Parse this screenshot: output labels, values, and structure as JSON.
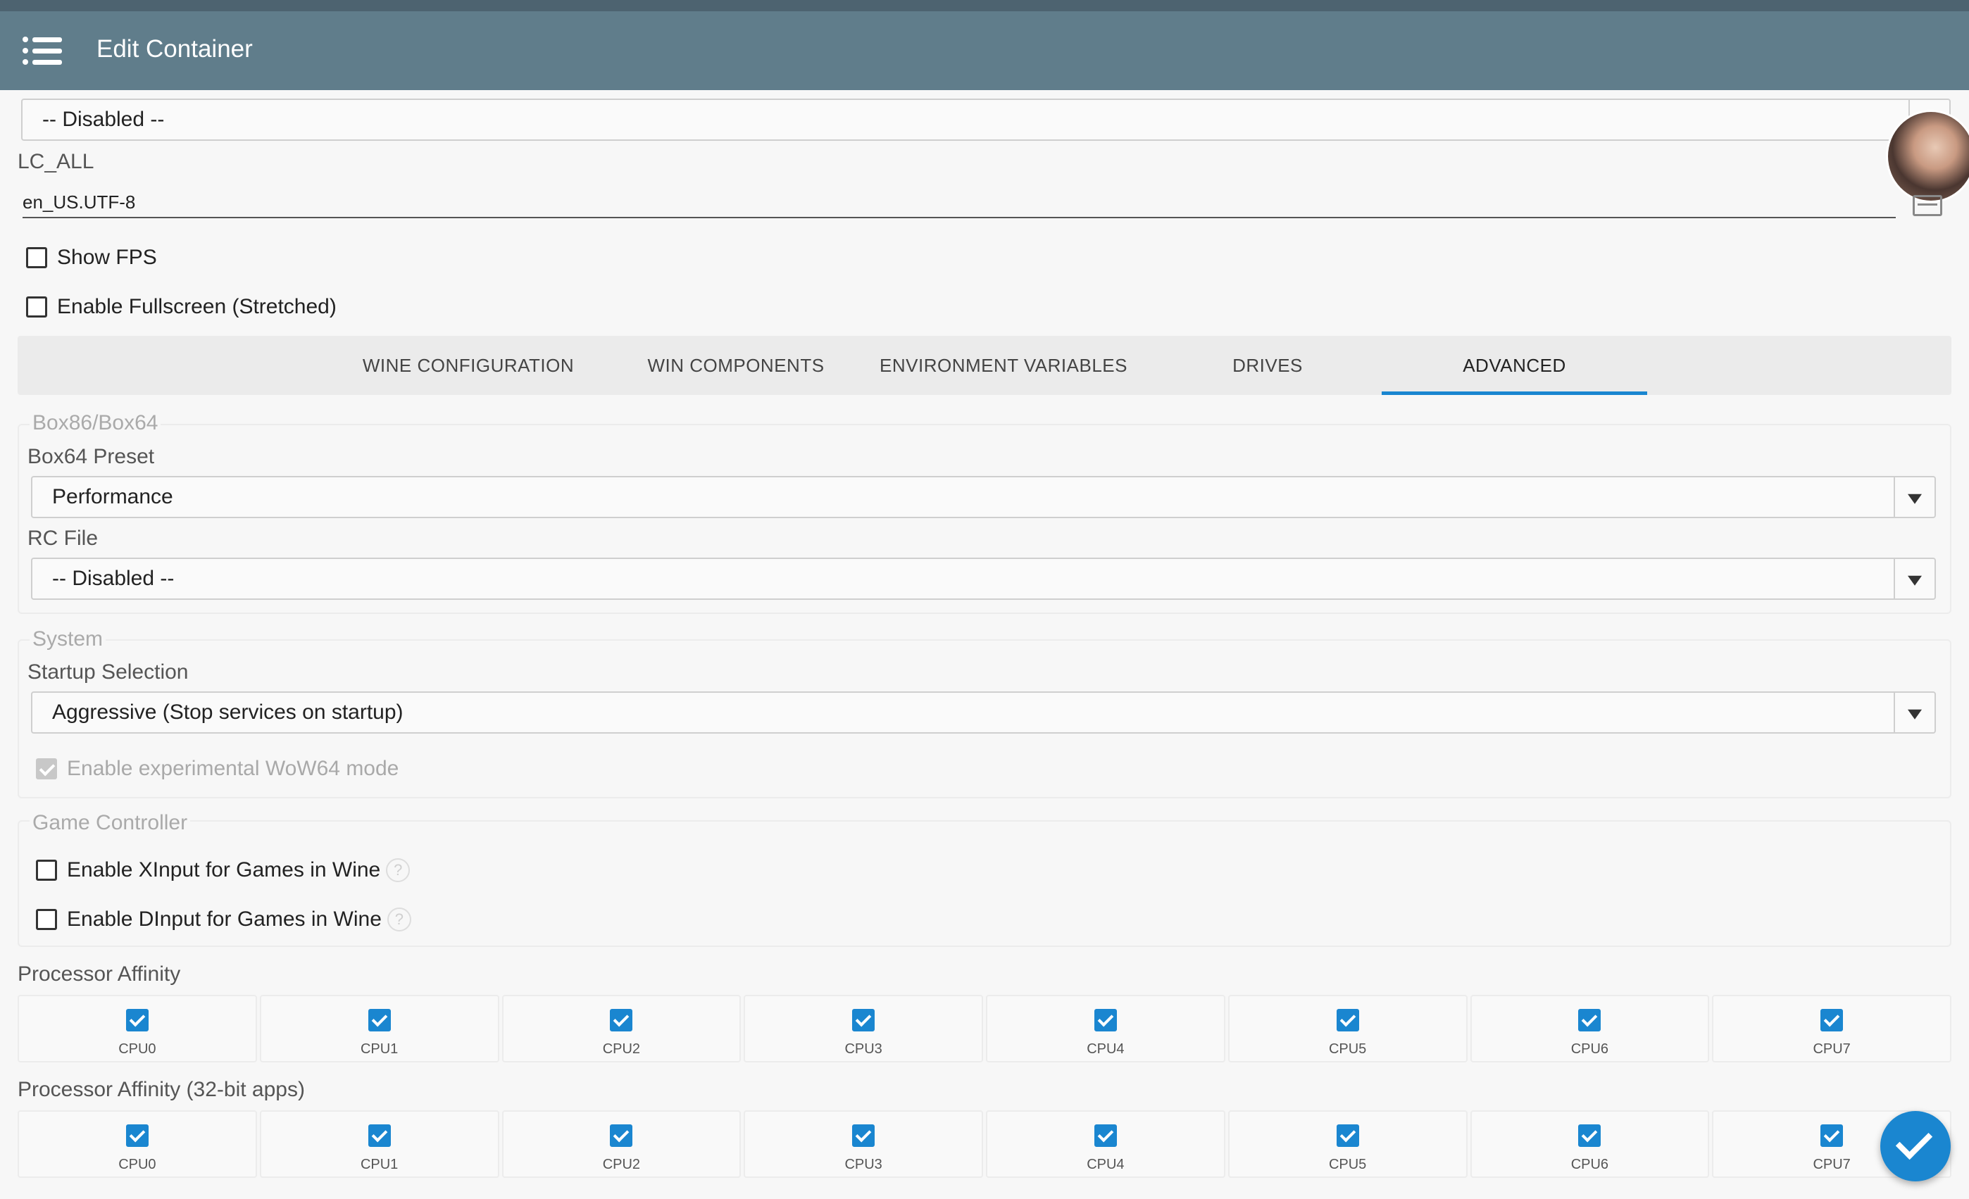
{
  "app": {
    "title": "Edit Container"
  },
  "top": {
    "select_value": "-- Disabled --",
    "lc_all_label": "LC_ALL",
    "lc_all_value": "en_US.UTF-8",
    "show_fps": {
      "label": "Show FPS",
      "checked": false
    },
    "fullscreen": {
      "label": "Enable Fullscreen (Stretched)",
      "checked": false
    }
  },
  "tabs": [
    {
      "label": "WINE CONFIGURATION",
      "active": false
    },
    {
      "label": "WIN COMPONENTS",
      "active": false
    },
    {
      "label": "ENVIRONMENT VARIABLES",
      "active": false
    },
    {
      "label": "DRIVES",
      "active": false
    },
    {
      "label": "ADVANCED",
      "active": true
    }
  ],
  "box": {
    "group_title": "Box86/Box64",
    "preset_label": "Box64 Preset",
    "preset_value": "Performance",
    "rc_label": "RC File",
    "rc_value": "-- Disabled --"
  },
  "system": {
    "group_title": "System",
    "startup_label": "Startup Selection",
    "startup_value": "Aggressive (Stop services on startup)",
    "wow64": {
      "label": "Enable experimental WoW64 mode",
      "checked": true,
      "disabled": true
    }
  },
  "controller": {
    "group_title": "Game Controller",
    "xinput": {
      "label": "Enable XInput for Games in Wine",
      "checked": false
    },
    "dinput": {
      "label": "Enable DInput for Games in Wine",
      "checked": false
    },
    "help_glyph": "?"
  },
  "affinity": {
    "label": "Processor Affinity",
    "cpus": [
      "CPU0",
      "CPU1",
      "CPU2",
      "CPU3",
      "CPU4",
      "CPU5",
      "CPU6",
      "CPU7"
    ]
  },
  "affinity32": {
    "label": "Processor Affinity (32-bit apps)",
    "cpus": [
      "CPU0",
      "CPU1",
      "CPU2",
      "CPU3",
      "CPU4",
      "CPU5",
      "CPU6",
      "CPU7"
    ]
  },
  "colors": {
    "appbar": "#607d8b",
    "accent": "#1a86d0"
  },
  "icons": {
    "menu": "menu-icon",
    "confirm": "check-icon",
    "help": "help-icon"
  }
}
